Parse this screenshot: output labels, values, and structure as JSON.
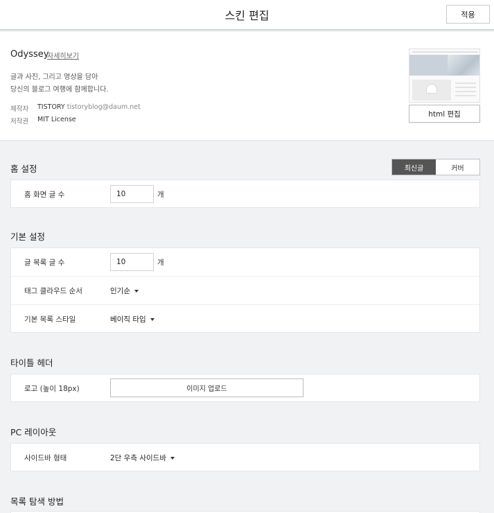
{
  "header": {
    "title": "스킨 편집",
    "apply_label": "적용"
  },
  "skin": {
    "name": "Odyssey",
    "detail_link": "자세히보기",
    "description_line1": "글과 사진, 그리고 영상을 담아",
    "description_line2": "당신의 블로그 여행에 함께합니다.",
    "author_label": "제작자",
    "author_name": "TISTORY",
    "author_email": "tistoryblog@daum.net",
    "license_label": "저작권",
    "license_value": "MIT License",
    "html_edit_label": "html 편집"
  },
  "home_settings": {
    "title": "홈 설정",
    "toggle": {
      "option1": "최신글",
      "option2": "커버",
      "selected": "최신글"
    },
    "post_count_label": "홈 화면 글 수",
    "post_count_value": "10",
    "unit": "개"
  },
  "basic_settings": {
    "title": "기본 설정",
    "post_list_label": "글 목록 글 수",
    "post_list_value": "10",
    "unit": "개",
    "tag_cloud_label": "태그 클라우드 순서",
    "tag_cloud_value": "인기순",
    "list_style_label": "기본 목록 스타일",
    "list_style_value": "베이직 타입"
  },
  "title_header": {
    "title": "타이틀 헤더",
    "logo_label": "로고 (높이 18px)",
    "upload_label": "이미지 업로드"
  },
  "pc_layout": {
    "title": "PC 레이아웃",
    "sidebar_label": "사이드바 형태",
    "sidebar_value": "2단 우측 사이드바"
  },
  "list_navigation": {
    "title": "목록 탐색 방법"
  }
}
